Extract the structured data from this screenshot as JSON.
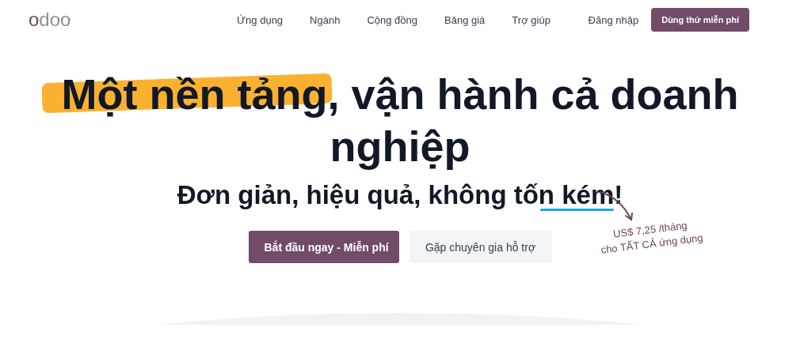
{
  "header": {
    "logo": "odoo",
    "nav": [
      {
        "label": "Ứng dụng"
      },
      {
        "label": "Ngành"
      },
      {
        "label": "Cộng đồng"
      },
      {
        "label": "Bảng giá"
      },
      {
        "label": "Trợ giúp"
      }
    ],
    "login": "Đăng nhập",
    "cta": "Dùng thử miễn phí"
  },
  "hero": {
    "headline": {
      "marked": "Một nền tảng",
      "after": ", vận hành cả doanh nghiệp"
    },
    "subheadline": {
      "before": "Đơn giản, hiệu quả, không tố",
      "marked": "n kém",
      "after": "!"
    },
    "buttons": [
      {
        "label": "Bắt đầu ngay - Miễn phí",
        "kind": "primary"
      },
      {
        "label": "Gặp chuyên gia hỗ trợ",
        "kind": "secondary"
      }
    ],
    "price_note": [
      "US$ 7,25 /tháng",
      "cho TẤT CẢ ứng dụng"
    ]
  }
}
